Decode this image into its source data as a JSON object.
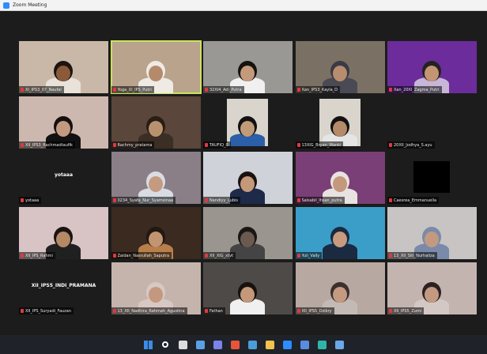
{
  "window": {
    "title": "Zoom Meeting"
  },
  "tiles": [
    {
      "name": "XI_IPS3_07_Naufal",
      "bg": "#c9b8a8",
      "skin": "#8a5a3a",
      "hair": "#1c1410",
      "shirt": "#e8e2d8"
    },
    {
      "name": "Yoga_XI_IPS_Putri",
      "bg": "#b9a38c",
      "skin": "#b58a6a",
      "hair": "#efeae4",
      "shirt": "#efeae4",
      "active": true
    },
    {
      "name": "32XI4_Adi_Putra",
      "bg": "#9a9894",
      "skin": "#c59a7a",
      "hair": "#161210",
      "shirt": "#f0f0f0"
    },
    {
      "name": "Xan_IPS3_Kayla_D",
      "bg": "#7a7064",
      "skin": "#b88c6e",
      "hair": "#3a3a45",
      "shirt": "#4a4a55"
    },
    {
      "name": "Xan_20XI_Zagma_Putri",
      "bg": "#6c2c9c",
      "skin": "#c39572",
      "hair": "#222",
      "shirt": "#c7b6d8"
    },
    {
      "name": "XII_IPS3_Rachmadtaufik",
      "bg": "#cdb8b0",
      "skin": "#c29a82",
      "hair": "#15100e",
      "shirt": "#111"
    },
    {
      "name": "Rachmy_pratama",
      "bg": "#5a463a",
      "skin": "#b8926e",
      "hair": "#2a1d15",
      "shirt": "#3a2e25"
    },
    {
      "name": "TAUFIQ_0",
      "bg": "#1c1c1c",
      "skin": "#c19a78",
      "hair": "#111",
      "shirt": "#2b5fa8",
      "small": true
    },
    {
      "name": "13XIG_Bryan_Wanki",
      "bg": "#1c1c1c",
      "skin": "#b48a68",
      "hair": "#111",
      "shirt": "#e5e5e5",
      "small": true
    },
    {
      "name": "20XII_Jodhya_S.ayu",
      "bg": "#1c1c1c",
      "empty": true
    },
    {
      "name": "yotaaa",
      "bg": "#1c1c1c",
      "empty": true,
      "center": "yotaaa"
    },
    {
      "name": "0234_Syafa_Nur_Syamsinaa",
      "bg": "#8a7f86",
      "skin": "#c59a80",
      "hair": "#d8dde4",
      "shirt": "#d8dde4"
    },
    {
      "name": "Nandiyy_Lubis",
      "bg": "#cfd2d8",
      "skin": "#c4987a",
      "hair": "#1a1210",
      "shirt": "#1e2a4a"
    },
    {
      "name": "Salsabil_Ihsan_putra",
      "bg": "#7a3f76",
      "skin": "#c3987c",
      "hair": "#e8e2e0",
      "shirt": "#e8e2e0"
    },
    {
      "name": "Caesrea_Emmanuella",
      "bg": "#1c1c1c",
      "black": true
    },
    {
      "name": "XII_IPS_Rahmi",
      "bg": "#d8c4c4",
      "skin": "#b58866",
      "hair": "#1a1410",
      "shirt": "#202020"
    },
    {
      "name": "Zaidan_Nasrullah_Saputra",
      "bg": "#3a2a20",
      "skin": "#c29470",
      "hair": "#1f1814",
      "shirt": "#b97f4a"
    },
    {
      "name": "XII_XIG_xtvt",
      "bg": "#9b958f",
      "skin": "#6a5a50",
      "hair": "#1a1614",
      "shirt": "#444"
    },
    {
      "name": "Yuli_Vally",
      "bg": "#3b9ec9",
      "skin": "#c89a7e",
      "hair": "#1a2a40",
      "shirt": "#1a2a40"
    },
    {
      "name": "13_XII_Siti_Nurhaliza",
      "bg": "#c8c4c4",
      "skin": "#c39a80",
      "hair": "#7a8aa8",
      "shirt": "#7a8aa8"
    },
    {
      "name": "XII_IPS_Suryadi_Fauzan",
      "bg": "#1c1c1c",
      "empty": true,
      "center": "XII_IPS5_INDI_PRAMANA"
    },
    {
      "name": "13_XII_Nadhira_Rahmah_Agustina",
      "bg": "#c4b4ac",
      "skin": "#c4987e",
      "hair": "#d8c8c4",
      "shirt": "#d8c8c4"
    },
    {
      "name": "Fathan",
      "bg": "#4e4a48",
      "skin": "#c49878",
      "hair": "#161210",
      "shirt": "#f0f0f0"
    },
    {
      "name": "XII_IPS5_Dzikry",
      "bg": "#b8a8a2",
      "skin": "#c49a80",
      "hair": "#3a3030",
      "shirt": "#c3bab6"
    },
    {
      "name": "XII_IPS5_Zumi",
      "bg": "#c4b4b0",
      "skin": "#c39a80",
      "hair": "#2a2222",
      "shirt": "#d4c8c4"
    }
  ],
  "taskbar": [
    {
      "icon": "windows-start-icon",
      "color": "#3c8ce7"
    },
    {
      "icon": "search-icon",
      "color": "#ffffff"
    },
    {
      "icon": "task-view-icon",
      "color": "#dcdcdc"
    },
    {
      "icon": "widgets-icon",
      "color": "#5aa0e6"
    },
    {
      "icon": "chat-icon",
      "color": "#7b83eb"
    },
    {
      "icon": "office-icon",
      "color": "#e8533c"
    },
    {
      "icon": "settings-icon",
      "color": "#4c9cd8"
    },
    {
      "icon": "file-explorer-icon",
      "color": "#f2c14e"
    },
    {
      "icon": "zoom-icon",
      "color": "#2d8cff"
    },
    {
      "icon": "mail-icon",
      "color": "#5a8be0"
    },
    {
      "icon": "edge-icon",
      "color": "#2fb6a8"
    },
    {
      "icon": "store-icon",
      "color": "#6aa8e8"
    }
  ]
}
